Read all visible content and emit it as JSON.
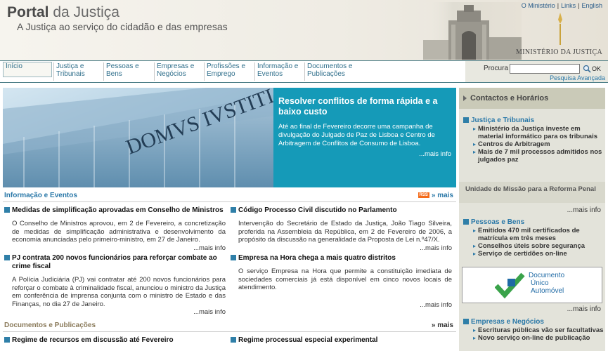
{
  "header": {
    "title_bold": "Portal",
    "title_light": "da Justiça",
    "subtitle": "A Justiça ao serviço do cidadão e das empresas",
    "top_links": [
      "O Ministério",
      "Links",
      "English"
    ],
    "ministry_name": "MINISTÉRIO DA JUSTIÇA"
  },
  "nav": {
    "items": [
      {
        "label": "Início"
      },
      {
        "label": "Justiça e Tribunais"
      },
      {
        "label": "Pessoas e Bens"
      },
      {
        "label": "Empresas e Negócios"
      },
      {
        "label": "Profissões e Emprego"
      },
      {
        "label": "Informação e Eventos"
      },
      {
        "label": "Documentos e Publicações"
      }
    ],
    "search_label": "Procura",
    "search_button": "OK",
    "advanced_search": "Pesquisa Avançada"
  },
  "banner": {
    "building_text": "DOMVS IVSTITIÆ",
    "title": "Resolver conflitos de forma rápida e a baixo custo",
    "body": "Até ao final de Fevereiro decorre uma campanha de divulgação do Julgado de Paz de Lisboa e Centro de Arbitragem de Conflitos de Consumo de Lisboa.",
    "more": "...mais info"
  },
  "info_section": {
    "title": "Informação e Eventos",
    "rss": "RSS",
    "more": "» mais",
    "news": [
      {
        "title": "Medidas de simplificação aprovadas em Conselho de Ministros",
        "body": "O Conselho de Ministros aprovou, em 2 de Fevereiro, a concretização de medidas de simplificação administrativa e desenvolvimento da economia anunciadas pelo primeiro-ministro, em 27 de Janeiro.",
        "more": "...mais info"
      },
      {
        "title": "Código Processo Civil discutido no Parlamento",
        "body": "Intervenção do Secretário de Estado da Justiça, João Tiago Silveira, proferida na Assembleia da República, em 2 de Fevereiro de 2006, a propósito da discussão na generalidade da Proposta de Lei n.º47/X.",
        "more": "...mais info"
      },
      {
        "title": "PJ contrata 200 novos funcionários para reforçar combate ao crime fiscal",
        "body": "A Polícia Judiciária (PJ) vai contratar até 200 novos funcionários para reforçar o combate à criminalidade fiscal, anunciou o ministro da Justiça em conferência de imprensa conjunta com o ministro de Estado e das Finanças, no dia 27 de Janeiro.",
        "more": "...mais info"
      },
      {
        "title": "Empresa na Hora chega a mais quatro distritos",
        "body": "O serviço Empresa na Hora que permite a constituição imediata de sociedades comerciais já está disponível em cinco novos locais de atendimento.",
        "more": "...mais info"
      }
    ]
  },
  "docs_section": {
    "title": "Documentos e Publicações",
    "more": "» mais",
    "items": [
      {
        "title": "Regime de recursos em discussão até Fevereiro"
      },
      {
        "title": "Regime processual especial experimental"
      }
    ]
  },
  "sidebar": {
    "contacts": "Contactos e Horários",
    "justica": {
      "title": "Justiça e Tribunais",
      "links": [
        "Ministério da Justiça investe em material informático para os tribunais",
        "Centros de Arbitragem",
        "Mais de 7 mil processos admitidos nos julgados paz"
      ]
    },
    "unit": "Unidade de Missão para a Reforma Penal",
    "unit_more": "...mais info",
    "pessoas": {
      "title": "Pessoas e Bens",
      "links": [
        "Emitidos 470 mil certificados de matrícula em três meses",
        "Conselhos úteis sobre segurança",
        "Serviço de certidões on-line"
      ]
    },
    "dua": {
      "line1": "Documento",
      "line2": "Único",
      "line3": "Automóvel"
    },
    "dua_more": "...mais info",
    "empresas": {
      "title": "Empresas e Negócios",
      "links": [
        "Escrituras públicas vão ser facultativas",
        "Novo serviço on-line de publicação"
      ]
    }
  }
}
